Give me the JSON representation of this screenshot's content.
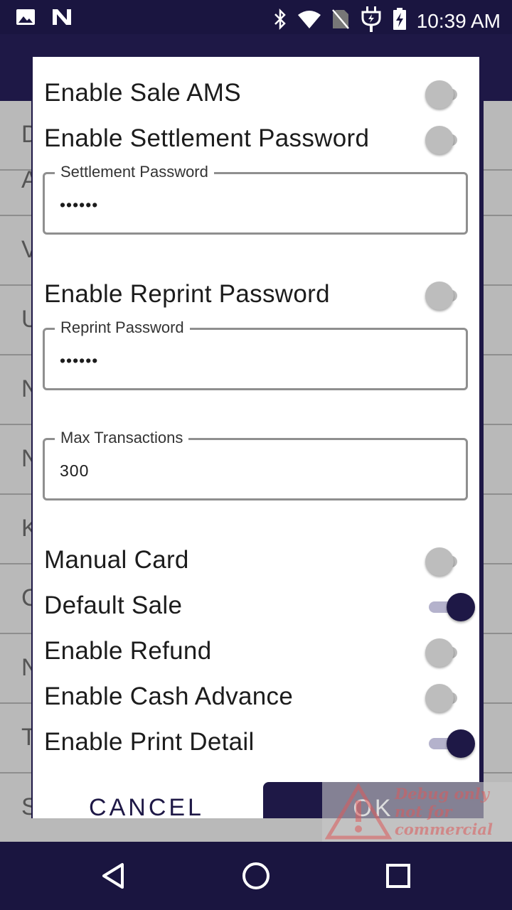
{
  "status_bar": {
    "time": "10:39 AM",
    "icons": [
      "image-icon",
      "n-app-icon",
      "bluetooth-icon",
      "wifi-icon",
      "no-sim-icon",
      "charging-plug-icon",
      "battery-charging-icon"
    ]
  },
  "background": {
    "row_initials": [
      "D",
      "A",
      "V",
      "U",
      "N",
      "N",
      "K",
      "C",
      "N",
      "T",
      "S"
    ]
  },
  "dialog": {
    "toggles_top": [
      {
        "label": "Enable Sale AMS",
        "checked": false
      },
      {
        "label": "Enable Settlement Password",
        "checked": false
      }
    ],
    "settlement_password": {
      "label": "Settlement Password",
      "value": "••••••"
    },
    "reprint_toggle": {
      "label": "Enable Reprint Password",
      "checked": false
    },
    "reprint_password": {
      "label": "Reprint Password",
      "value": "••••••"
    },
    "max_transactions": {
      "label": "Max Transactions",
      "value": "300"
    },
    "toggles_bottom": [
      {
        "label": "Manual Card",
        "checked": false
      },
      {
        "label": "Default Sale",
        "checked": true
      },
      {
        "label": "Enable Refund",
        "checked": false
      },
      {
        "label": "Enable Cash Advance",
        "checked": false
      },
      {
        "label": "Enable Print Detail",
        "checked": true
      }
    ],
    "cancel_label": "CANCEL",
    "ok_label": "OK"
  },
  "watermark": {
    "lines": [
      "Debug only",
      "not for",
      "commercial"
    ]
  },
  "colors": {
    "accent": "#1e1846",
    "switch_off": "#bdbdbd",
    "switch_on_track": "#b4b2cc"
  }
}
